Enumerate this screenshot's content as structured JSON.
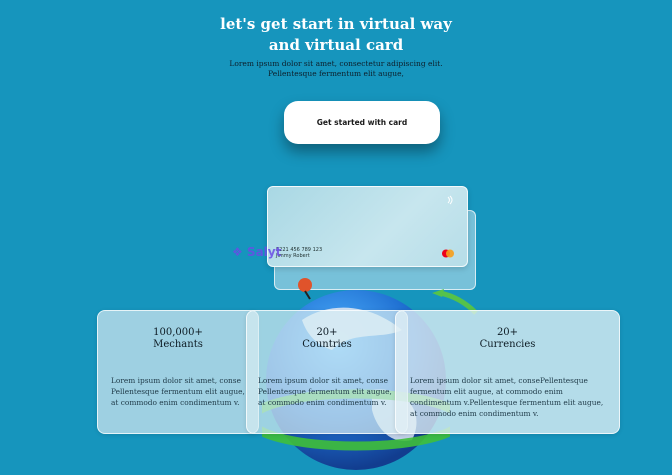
{
  "hero": {
    "title_line1": "let's get start in virtual way",
    "title_line2": "and virtual card",
    "subtitle_line1": "Lorem ipsum dolor sit amet, consectetur adipiscing elit.",
    "subtitle_line2": "Pellentesque fermentum elit augue,",
    "cta_label": "Get started with card"
  },
  "card": {
    "number": "5221 456 789 123",
    "holder": "Jimmy Robert",
    "watermark": "❖ Salyt"
  },
  "stats": [
    {
      "value": "100,000+",
      "label": "Mechants",
      "body": [
        "Lorem ipsum dolor sit amet, conse",
        "Pellentesque fermentum elit augue,",
        "at commodo enim condimentum v."
      ]
    },
    {
      "value": "20+",
      "label": "Countries",
      "body": [
        "Lorem ipsum dolor sit amet, conse",
        "Pellentesque fermentum elit augue,",
        "at commodo enim condimentum v."
      ]
    },
    {
      "value": "20+",
      "label": "Currencies",
      "body": [
        "Lorem ipsum dolor sit amet, consePellentesque",
        "fermentum elit augue, at commodo enim",
        "condimentum v.Pellentesque fermentum elit augue,",
        "at commodo enim condimentum v."
      ]
    }
  ],
  "colors": {
    "background": "#1695bd",
    "cta_background": "#ffffff",
    "title": "#ffffff"
  },
  "icons": [
    "contactless-icon",
    "mastercard-icon",
    "location-pin-icon",
    "globe-illustration",
    "arrow-icon"
  ]
}
